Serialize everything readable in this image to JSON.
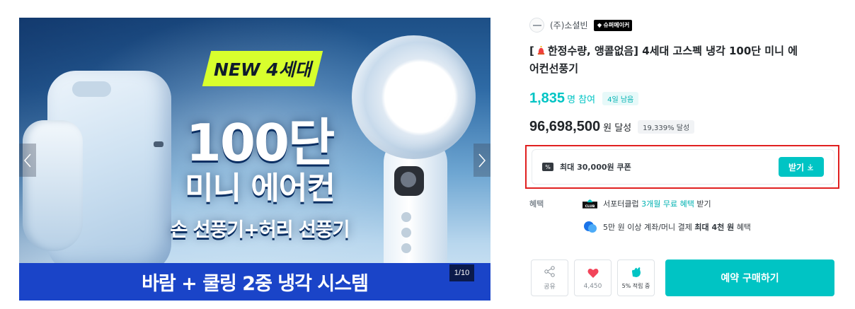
{
  "carousel": {
    "badge_new": "NEW 4세대",
    "headline_1": "100단",
    "headline_2": "미니 에어컨",
    "headline_3": "손 선풍기+허리 선풍기",
    "banner": "바람 + 쿨링 2중 냉각 시스템",
    "page_indicator": "1/10"
  },
  "maker": {
    "name": "(주)소셜빈",
    "badge": "슈퍼메이커"
  },
  "product": {
    "title_prefix": "[",
    "title_rest": "한정수량, 앵콜없음] 4세대 고스펙 냉각 100단 미니 에어컨선풍기"
  },
  "stats": {
    "participants": "1,835",
    "participants_unit": "명 참여",
    "days_left": "4일 남음",
    "amount": "96,698,500",
    "amount_unit": "원 달성",
    "achievement": "19,339% 달성"
  },
  "coupon": {
    "icon": "coupon-icon",
    "text": "최대 30,000원 쿠폰",
    "button": "받기"
  },
  "benefits": {
    "label": "혜택",
    "club_pre": "서포터클럽",
    "club_highlight": "3개월 무료 혜택",
    "club_post": "받기",
    "pay_pre": "5만 원 이상 계좌/머니 결제",
    "pay_strong": "최대 4천 원",
    "pay_post": "혜택"
  },
  "actions": {
    "share": "공유",
    "like_count": "4,450",
    "clap": "5% 적립 중",
    "buy": "예약 구매하기"
  },
  "colors": {
    "accent": "#00c4c4",
    "highlight_border": "#e02020",
    "banner_blue": "#1a44c8",
    "like_red": "#f2445a"
  }
}
